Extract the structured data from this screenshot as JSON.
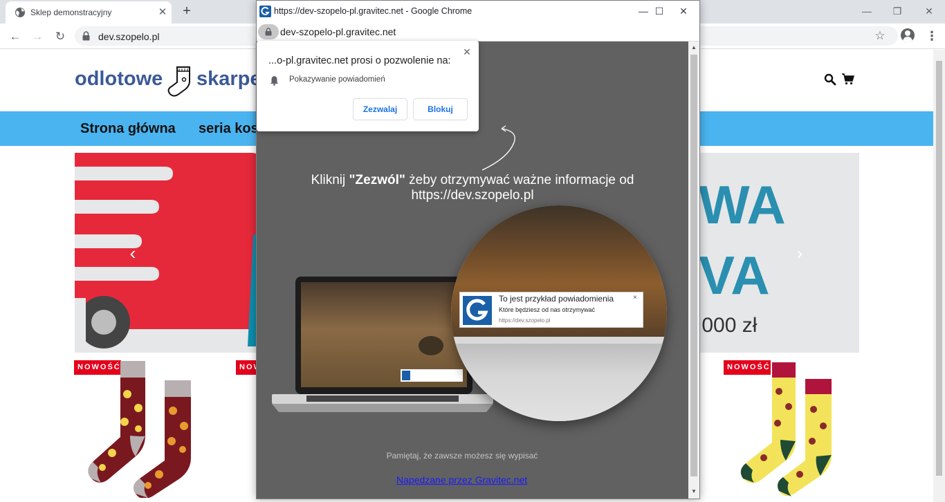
{
  "browser": {
    "tab_title": "Sklep demonstracyjny",
    "tab_close": "✕",
    "new_tab": "+",
    "url": "dev.szopelo.pl",
    "win_minimize": "—",
    "win_restore": "❐",
    "win_close": "✕"
  },
  "site": {
    "logo_part1": "odlotowe",
    "logo_part2": "skarpe",
    "nav": [
      "Strona główna",
      "seria kos"
    ],
    "banner": {
      "text_line1": "WA",
      "text_line2": "VA",
      "price": ".000 zł",
      "prev_arrow": "‹",
      "next_arrow": "›"
    },
    "badges": [
      "NOWOŚĆ",
      "NOW",
      "NOWOŚĆ"
    ],
    "colors": {
      "accent": "#4ab4f0",
      "logo": "#3b5998",
      "badge": "#e4001b"
    }
  },
  "popup": {
    "window_title": "https://dev-szopelo-pl.gravitec.net - Google Chrome",
    "url": "dev-szopelo-pl.gravitec.net",
    "minimize": "—",
    "maximize": "☐",
    "close": "✕",
    "cta_prefix": "Kliknij ",
    "cta_bold": "\"Zezwól\"",
    "cta_suffix": " żeby otrzymywać ważne informacje od https://dev.szopelo.pl",
    "notification": {
      "title": "To jest przykład powiadomienia",
      "body": "Które będziesz od nas otrzymywać",
      "url": "https://dev.szopelo.pl",
      "close": "×"
    },
    "remember": "Pamiętaj, że zawsze możesz się wypisać",
    "powered": "Napędzane przez Gravitec.net"
  },
  "permission": {
    "title": "...o-pl.gravitec.net prosi o pozwolenie na:",
    "item": "Pokazywanie powiadomień",
    "allow": "Zezwalaj",
    "block": "Blokuj",
    "close": "✕"
  }
}
